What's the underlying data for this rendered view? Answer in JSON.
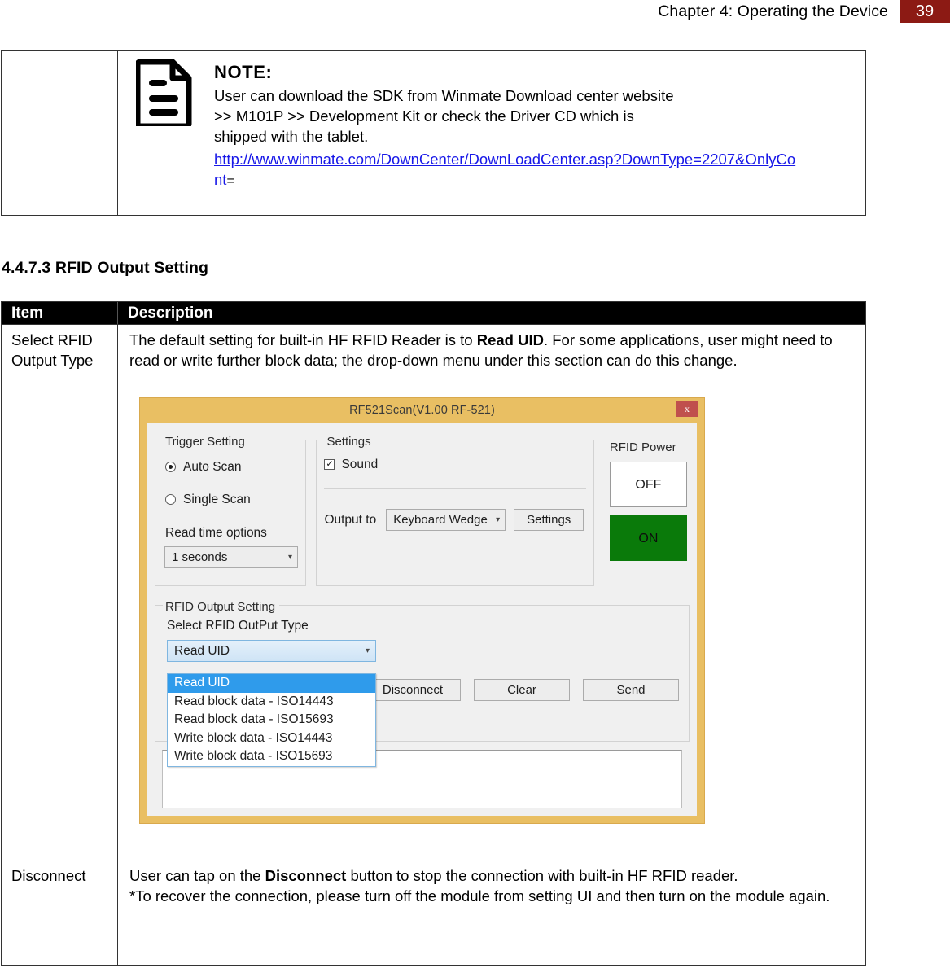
{
  "header": {
    "title": "Chapter 4: Operating the Device",
    "page_number": "39"
  },
  "note": {
    "icon": "document-note-icon",
    "label": "NOTE:",
    "line1": "User can download the SDK from Winmate Download center website",
    "line2": ">> M101P >> Development Kit or check the Driver CD which is",
    "line3": "shipped with the tablet.",
    "url_line1": "http://www.winmate.com/DownCenter/DownLoadCenter.asp?DownType=2207&OnlyCo",
    "url_line2": "nt",
    "url_suffix": "="
  },
  "section": {
    "heading": "4.4.7.3 RFID Output Setting"
  },
  "table": {
    "headers": {
      "item": "Item",
      "description": "Description"
    },
    "rows": [
      {
        "item": "Select RFID Output Type",
        "desc_before": "The default setting for built-in HF RFID Reader is to ",
        "desc_bold": "Read UID",
        "desc_after": ". For some applications, user might need to read or write further block data; the drop-down menu under this section can do this change."
      },
      {
        "item": "Disconnect",
        "desc_before": "User can tap on the ",
        "desc_bold": "Disconnect",
        "desc_after": " button to stop the connection with built-in HF RFID reader.",
        "desc_line2": "*To recover the connection, please turn off the module from setting UI and then turn on the module again."
      }
    ]
  },
  "app": {
    "title": "RF521Scan(V1.00 RF-521)",
    "close_label": "x",
    "close_icon": "close-icon",
    "trigger": {
      "legend": "Trigger Setting",
      "auto_scan": "Auto Scan",
      "single_scan": "Single Scan",
      "selected_radio": "Auto Scan",
      "read_time_label": "Read time options",
      "read_time_value": "1 seconds",
      "caret_icon": "chevron-down-icon"
    },
    "settings": {
      "legend": "Settings",
      "sound_label": "Sound",
      "sound_checked": "✓",
      "output_to_label": "Output to",
      "output_to_value": "Keyboard Wedge",
      "settings_button": "Settings"
    },
    "power": {
      "title": "RFID Power",
      "off_label": "OFF",
      "on_label": "ON",
      "on_color": "#0A7A0A"
    },
    "output_setting": {
      "legend": "RFID Output Setting",
      "select_label": "Select RFID OutPut Type",
      "selected_value": "Read UID",
      "options": [
        "Read UID",
        "Read block data - ISO14443",
        "Read block data - ISO15693",
        "Write block data - ISO14443",
        "Write block data - ISO15693"
      ],
      "highlight_color": "#2F9BEB"
    },
    "buttons": {
      "disconnect": "Disconnect",
      "clear": "Clear",
      "send": "Send"
    },
    "output_textarea_value": ""
  },
  "colors": {
    "page_badge": "#8C1A14",
    "window_frame": "#E9BF63",
    "close_button": "#C0504D",
    "link": "#1818E8"
  }
}
